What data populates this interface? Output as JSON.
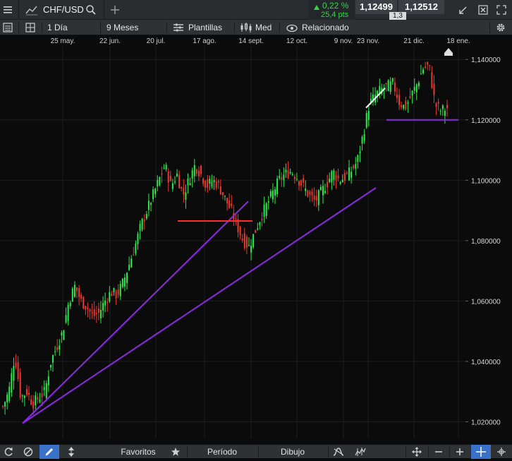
{
  "window": {
    "symbol": "CHF/USD"
  },
  "quote": {
    "change_pct": "0,22 %",
    "change_pts": "25,4 pts",
    "bid": "1,12499",
    "ask": "1,12512",
    "spread": "1,3"
  },
  "toolbar": {
    "interval": "1 Día",
    "range": "9 Meses",
    "templates": "Plantillas",
    "chart_style": "Med",
    "related": "Relacionado"
  },
  "bottom": {
    "favorites": "Favoritos",
    "period": "Período",
    "drawing": "Dibujo"
  },
  "colors": {
    "up": "#2ee84c",
    "down": "#e83a2e",
    "trendline": "#8a2be2",
    "support": "#ff2a2a",
    "background": "#0b0b0b"
  },
  "icons": [
    "menu-icon",
    "line-chart-icon",
    "search-icon",
    "plus-icon",
    "arrow-up-icon",
    "collapse-icon",
    "close-icon",
    "expand-icon",
    "grid-layout-icon",
    "chart-type-icon",
    "eye-icon",
    "gear-icon",
    "refresh-icon",
    "no-icon",
    "pencil-icon",
    "arrows-vertical-icon",
    "star-icon",
    "wave-icon",
    "candlestick-icon",
    "zoom-fit-icon",
    "minus-icon",
    "crosshair-icon"
  ],
  "chart_data": {
    "type": "candlestick",
    "x_tick_labels": [
      "25 may.",
      "22 jun.",
      "20 jul.",
      "17 ago.",
      "14 sept.",
      "12 oct.",
      "9 nov.",
      "23 nov.",
      "21 dic.",
      "18 ene."
    ],
    "y_tick_labels": [
      "1,140000",
      "1,120000",
      "1,100000",
      "1,080000",
      "1,060000",
      "1,040000",
      "1,020000"
    ],
    "ylim": [
      1.0145,
      1.1445
    ],
    "grid": true,
    "close_series": [
      1.025,
      1.03,
      1.042,
      1.028,
      1.03,
      1.026,
      1.028,
      1.03,
      1.04,
      1.045,
      1.05,
      1.06,
      1.065,
      1.06,
      1.058,
      1.055,
      1.056,
      1.06,
      1.063,
      1.062,
      1.066,
      1.072,
      1.078,
      1.085,
      1.09,
      1.095,
      1.1,
      1.105,
      1.098,
      1.102,
      1.095,
      1.1,
      1.105,
      1.102,
      1.098,
      1.1,
      1.098,
      1.094,
      1.09,
      1.085,
      1.08,
      1.078,
      1.083,
      1.088,
      1.092,
      1.096,
      1.1,
      1.102,
      1.103,
      1.101,
      1.098,
      1.095,
      1.093,
      1.096,
      1.099,
      1.103,
      1.1,
      1.101,
      1.103,
      1.106,
      1.115,
      1.125,
      1.128,
      1.13,
      1.131,
      1.132,
      1.126,
      1.124,
      1.128,
      1.132,
      1.137,
      1.138,
      1.125,
      1.123,
      1.124
    ],
    "trendlines": [
      {
        "color": "purple",
        "from": {
          "x": "25 may.",
          "y": 1.0195
        },
        "to": {
          "x": "14 sept.",
          "y": 1.093
        }
      },
      {
        "color": "purple",
        "from": {
          "x": "25 may.",
          "y": 1.0195
        },
        "to": {
          "x": "23 nov.",
          "y": 1.0975
        }
      },
      {
        "color": "purple",
        "from": {
          "x": "21 dic.",
          "y": 1.12
        },
        "to": {
          "x": "18 ene.",
          "y": 1.12
        }
      },
      {
        "color": "red",
        "from": {
          "x": "17 ago.",
          "y": 1.0865
        },
        "to": {
          "x": "14 sept.",
          "y": 1.0865
        }
      },
      {
        "color": "white",
        "from": {
          "x": "23 nov.",
          "y": 1.124
        },
        "to": {
          "x": "23 nov.",
          "y": 1.1305
        }
      }
    ]
  }
}
